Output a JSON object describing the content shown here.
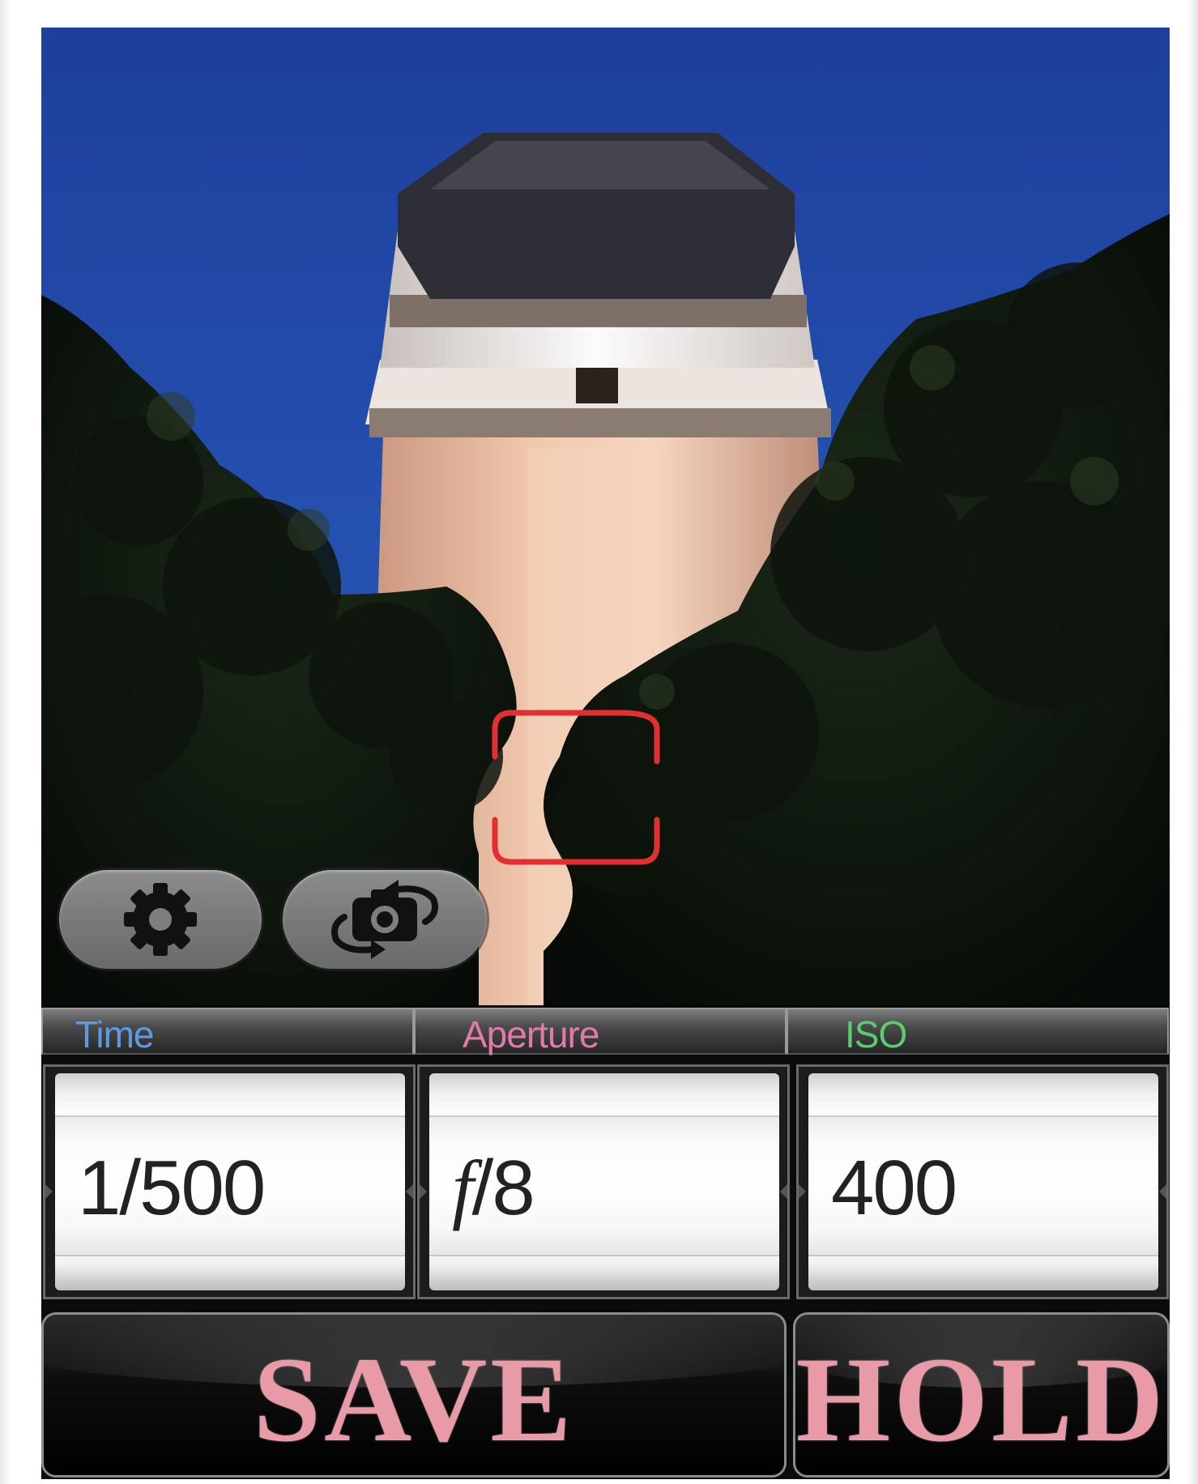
{
  "colors": {
    "time_label": "#5d9be0",
    "aperture_label": "#e07aaa",
    "iso_label": "#57cf6a",
    "button_text": "#e89aa7",
    "focus_frame": "#e23030"
  },
  "overlay": {
    "settings_icon": "gear-icon",
    "flip_camera_icon": "camera-flip-icon"
  },
  "panel": {
    "time": {
      "label": "Time",
      "value": "1/500"
    },
    "aperture": {
      "label": "Aperture",
      "value_prefix": "f",
      "value_suffix": "/8"
    },
    "iso": {
      "label": "ISO",
      "value": "400"
    }
  },
  "buttons": {
    "save": "SAVE",
    "hold": "HOLD"
  }
}
